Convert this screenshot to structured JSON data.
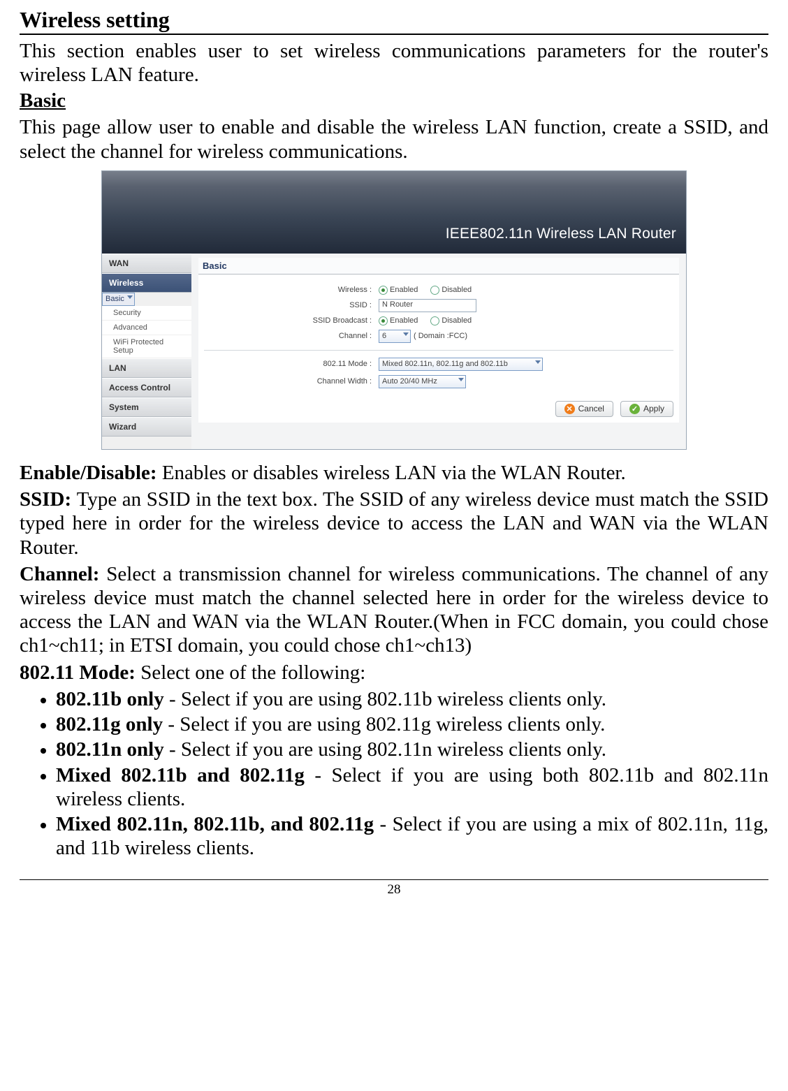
{
  "doc": {
    "title": "Wireless setting",
    "intro": "This section enables user to set wireless communications parameters for the router's wireless LAN feature.",
    "basic_heading": "Basic",
    "basic_para": "This page allow user to enable and disable the wireless LAN function, create a SSID, and select the channel for wireless communications.",
    "enable_label": "Enable/Disable: ",
    "enable_text": "Enables or disables wireless LAN via the WLAN Router.",
    "ssid_label": "SSID: ",
    "ssid_text": "Type an SSID in the text box. The SSID of any wireless device must match the SSID typed here in order for the wireless device to access the LAN and WAN via the WLAN Router.",
    "channel_label": "Channel: ",
    "channel_text": "Select a transmission channel for wireless communications. The channel of any wireless device must match the channel selected here in order for the wireless device to access the LAN and WAN via the WLAN Router.(When in FCC domain, you could chose ch1~ch11; in ETSI domain, you could chose ch1~ch13)",
    "mode_label": "802.11 Mode: ",
    "mode_text": "Select one of the following:",
    "modes": [
      {
        "b": "802.11b only",
        "t": " - Select if you are using 802.11b wireless clients only."
      },
      {
        "b": "802.11g only",
        "t": " - Select if you are using 802.11g wireless clients only."
      },
      {
        "b": "802.11n only",
        "t": " - Select if you are using 802.11n wireless clients only."
      },
      {
        "b": "Mixed 802.11b and 802.11g",
        "t": " - Select if you are using both 802.11b and 802.11n wireless clients."
      },
      {
        "b": "Mixed 802.11n, 802.11b, and 802.11g",
        "t": " - Select if you are using a mix of 802.11n, 11g, and 11b wireless clients."
      }
    ],
    "page_number": "28"
  },
  "ui": {
    "banner": "IEEE802.11n  Wireless LAN Router",
    "sidebar": {
      "sections": [
        "WAN",
        "Wireless",
        "LAN",
        "Access Control",
        "System",
        "Wizard"
      ],
      "wireless_sub": [
        "Basic",
        "Security",
        "Advanced",
        "WiFi Protected Setup"
      ],
      "active_section": "Wireless",
      "selected_sub": "Basic"
    },
    "panel": {
      "title": "Basic",
      "rows": {
        "wireless": {
          "label": "Wireless :",
          "enabled": "Enabled",
          "disabled": "Disabled",
          "sel": "enabled"
        },
        "ssid": {
          "label": "SSID :",
          "value": "N Router"
        },
        "ssid_bc": {
          "label": "SSID Broadcast :",
          "enabled": "Enabled",
          "disabled": "Disabled",
          "sel": "enabled"
        },
        "channel": {
          "label": "Channel :",
          "value": "6",
          "note": "( Domain :FCC)"
        },
        "mode": {
          "label": "802.11 Mode :",
          "value": "Mixed 802.11n, 802.11g and 802.11b"
        },
        "cwidth": {
          "label": "Channel Width :",
          "value": "Auto 20/40 MHz"
        }
      },
      "buttons": {
        "cancel": "Cancel",
        "apply": "Apply"
      }
    }
  }
}
